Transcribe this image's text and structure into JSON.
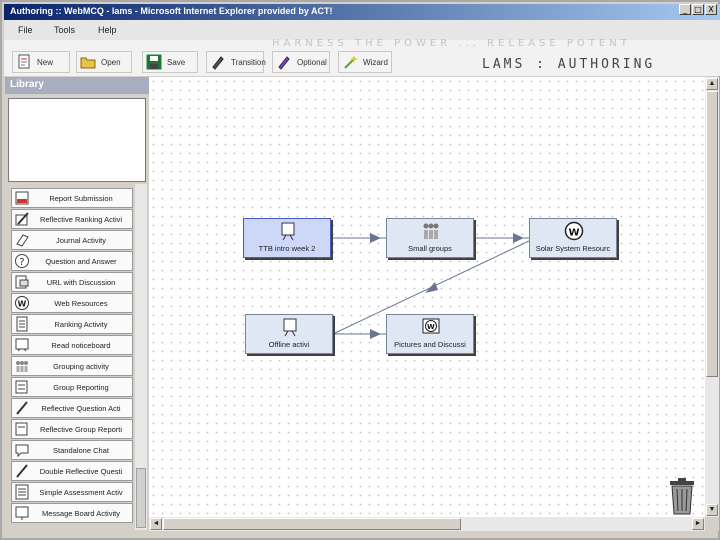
{
  "window": {
    "title": "Authoring :: WebMCQ - lams - Microsoft Internet Explorer provided by ACT!",
    "min_glyph": "_",
    "max_glyph": "□",
    "close_glyph": "X"
  },
  "menu": {
    "file": "File",
    "tools": "Tools",
    "help": "Help"
  },
  "toolbar": {
    "new": "New",
    "open": "Open",
    "save": "Save",
    "transition": "Transition",
    "optional": "Optional",
    "wizard": "Wizard"
  },
  "branding": {
    "title": "LAMS : AUTHORING",
    "banner": "HARNESS THE POWER ... RELEASE POTENT"
  },
  "library": {
    "title": "Library",
    "items": [
      {
        "label": "Report Submission",
        "icon": "report-icon"
      },
      {
        "label": "Reflective Ranking Activi",
        "icon": "pencil-icon"
      },
      {
        "label": "Journal Activity",
        "icon": "journal-icon"
      },
      {
        "label": "Question and Answer",
        "icon": "question-icon"
      },
      {
        "label": "URL with Discussion",
        "icon": "url-icon"
      },
      {
        "label": "Web Resources",
        "icon": "web-icon"
      },
      {
        "label": "Ranking Activity",
        "icon": "ranking-icon"
      },
      {
        "label": "Read noticeboard",
        "icon": "noticeboard-icon"
      },
      {
        "label": "Grouping activity",
        "icon": "group-icon"
      },
      {
        "label": "Group Reporting",
        "icon": "group-report-icon"
      },
      {
        "label": "Reflective Question Acti",
        "icon": "pencil-icon"
      },
      {
        "label": "Reflective Group Reporti",
        "icon": "group-report-icon"
      },
      {
        "label": "Standalone Chat",
        "icon": "chat-icon"
      },
      {
        "label": "Double Reflective Questi",
        "icon": "pencil-icon"
      },
      {
        "label": "Simple Assessment Activ",
        "icon": "assessment-icon"
      },
      {
        "label": "Message Board Activity",
        "icon": "board-icon"
      }
    ]
  },
  "canvas": {
    "activities": {
      "ttb": {
        "label": "TTB intro week 2",
        "selected": true
      },
      "small_groups": {
        "label": "Small groups"
      },
      "solar": {
        "label": "Solar System Resourc"
      },
      "offline": {
        "label": "Offline activi"
      },
      "pictures": {
        "label": "Pictures and Discussi"
      }
    }
  },
  "scroll": {
    "up": "▲",
    "down": "▼",
    "left": "◄",
    "right": "►"
  },
  "colors": {
    "titlebar": "#0a246a",
    "activity_fill": "#dfe7f5",
    "arrow": "#6a7590"
  }
}
